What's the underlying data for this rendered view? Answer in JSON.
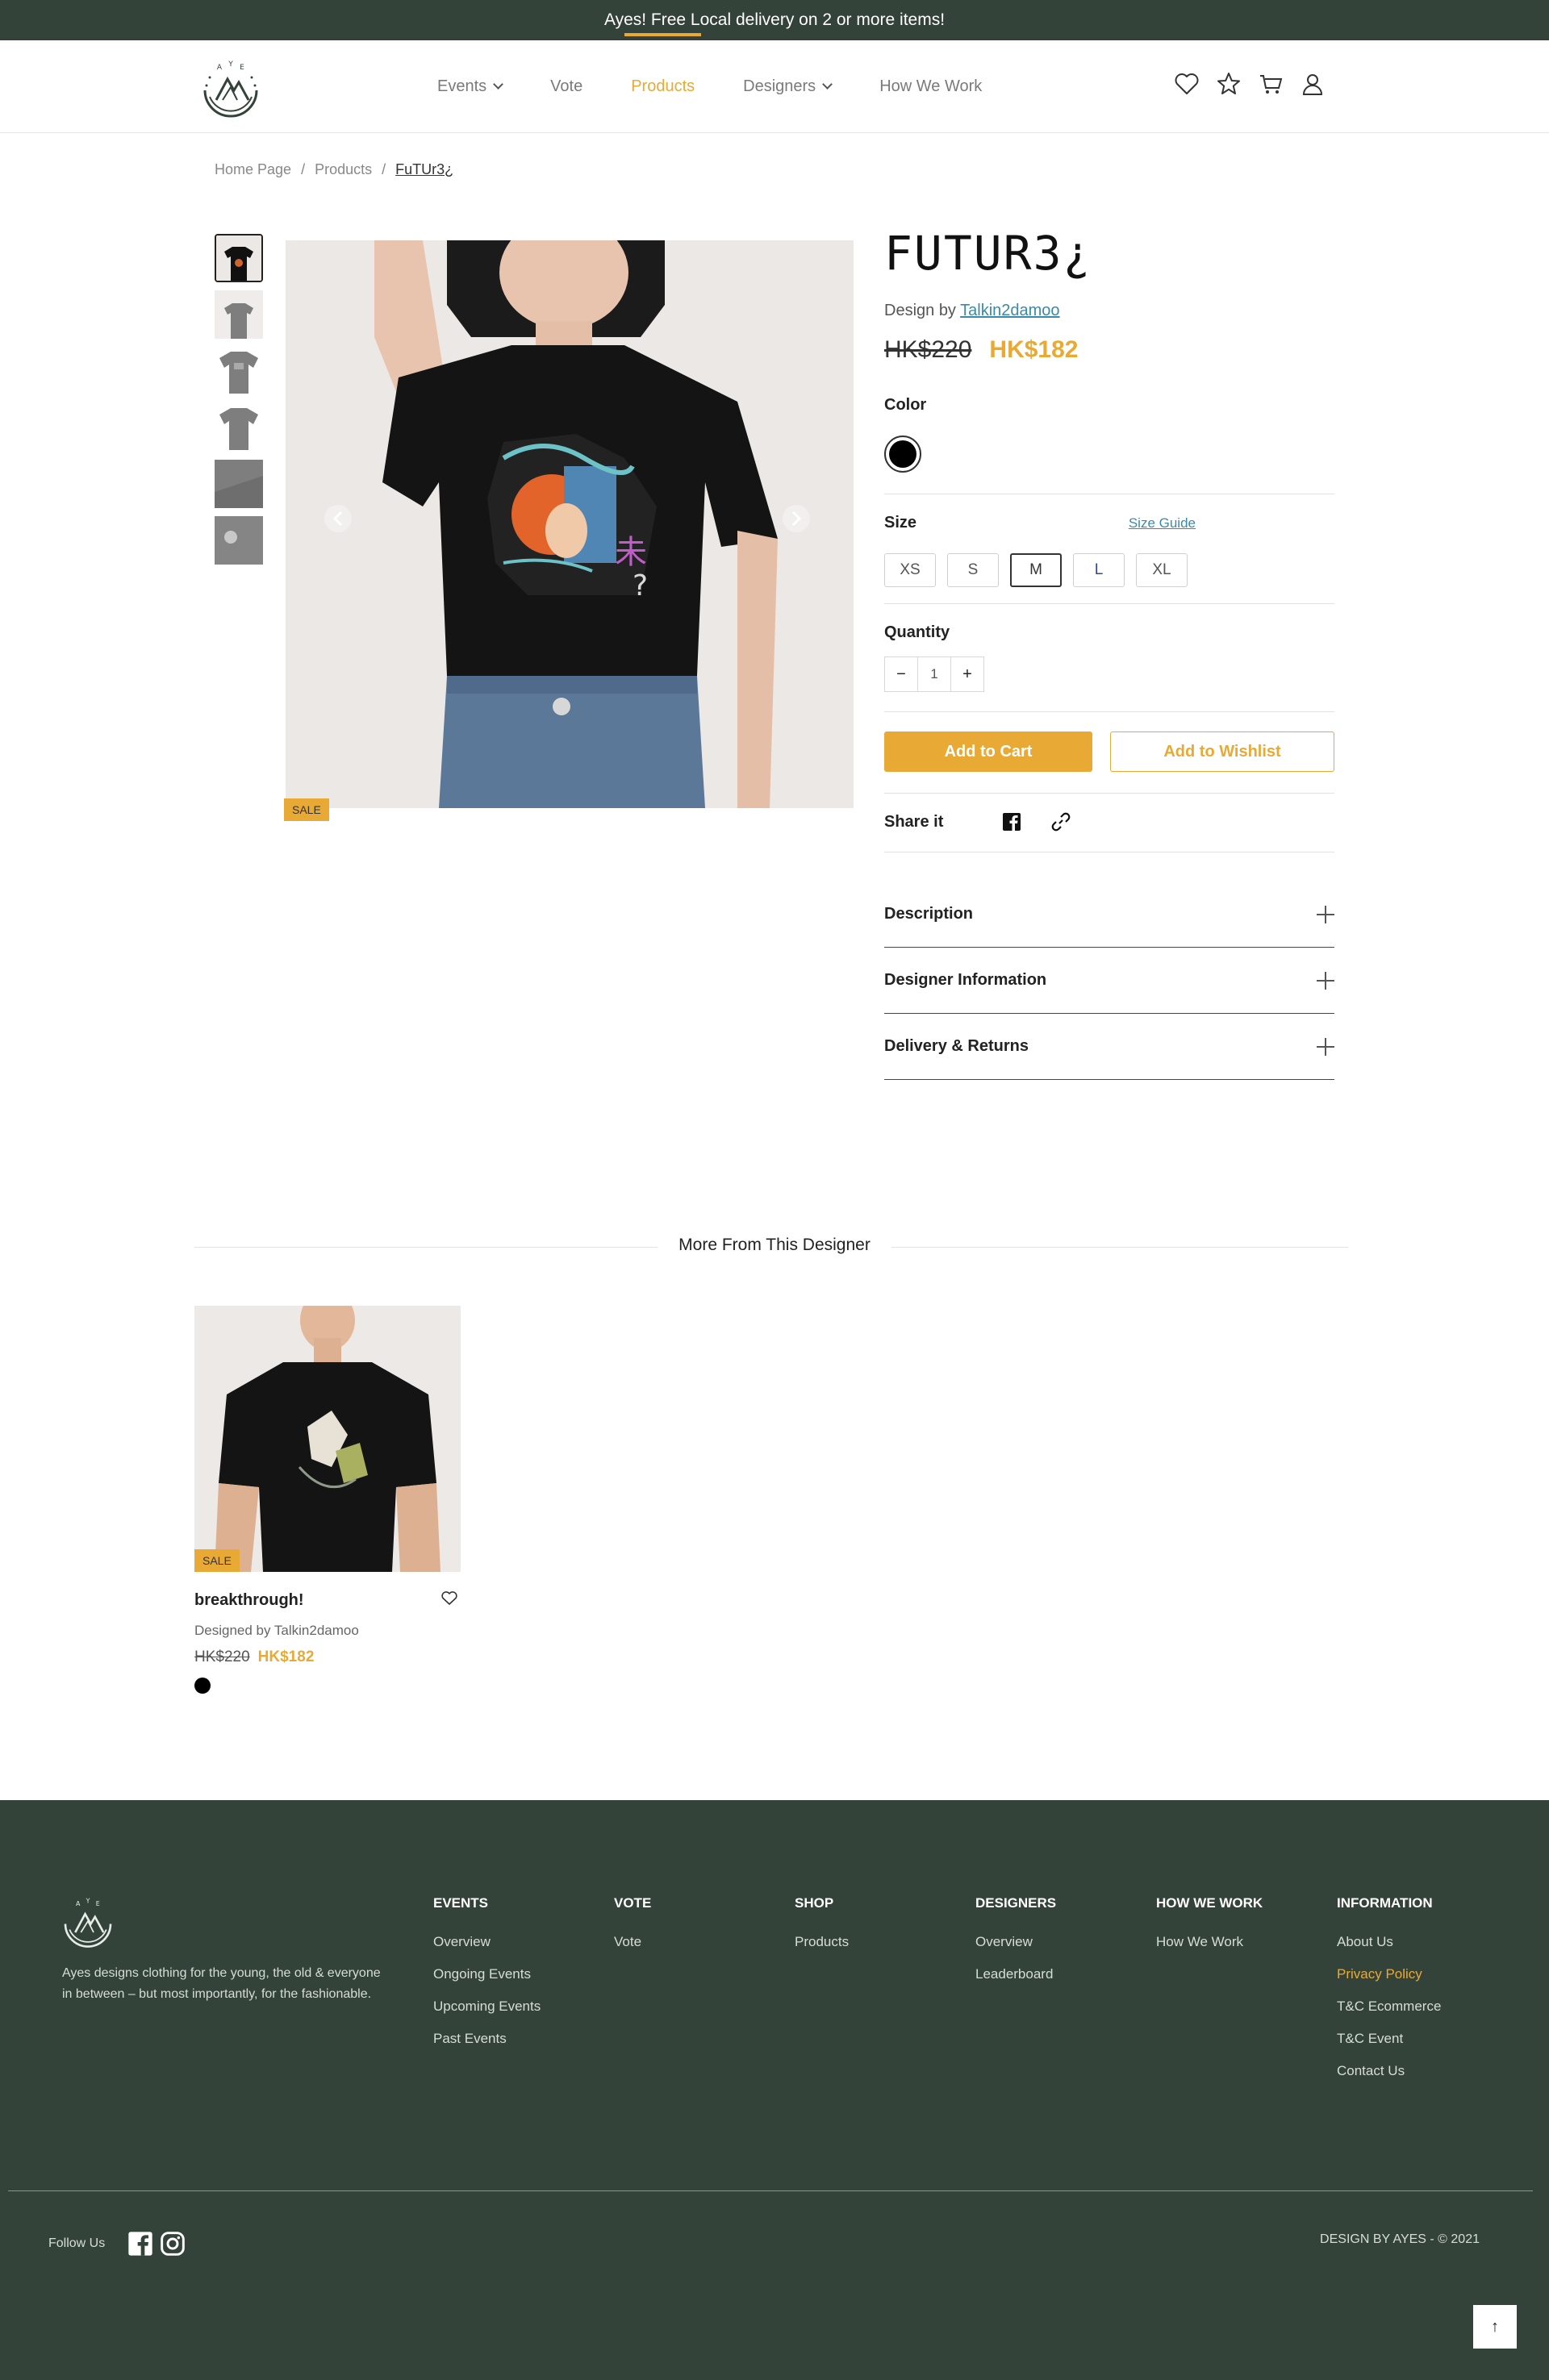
{
  "promo": {
    "text": "Ayes! Free Local delivery on 2 or more items!"
  },
  "nav": {
    "items": [
      {
        "label": "Events",
        "has_dropdown": true
      },
      {
        "label": "Vote",
        "has_dropdown": false
      },
      {
        "label": "Products",
        "has_dropdown": false,
        "active": true
      },
      {
        "label": "Designers",
        "has_dropdown": true
      },
      {
        "label": "How We Work",
        "has_dropdown": false
      }
    ],
    "icons": [
      "heart-icon",
      "star-icon",
      "cart-icon",
      "user-icon"
    ]
  },
  "breadcrumb": {
    "home": "Home Page",
    "products": "Products",
    "current": "FuTUr3¿"
  },
  "product": {
    "title": "FUTUR3¿",
    "design_by_prefix": "Design by",
    "designer": "Talkin2damoo",
    "old_price": "HK$220",
    "new_price": "HK$182",
    "sale_badge": "SALE",
    "color_label": "Color",
    "selected_color": "#000000",
    "size_label": "Size",
    "size_guide": "Size Guide",
    "sizes": [
      "XS",
      "S",
      "M",
      "L",
      "XL"
    ],
    "selected_size": "M",
    "quantity_label": "Quantity",
    "quantity": "1",
    "add_to_cart": "Add to Cart",
    "add_to_wishlist": "Add to Wishlist",
    "share_label": "Share it",
    "accordions": [
      "Description",
      "Designer Information",
      "Delivery & Returns"
    ]
  },
  "more": {
    "title": "More From This Designer",
    "items": [
      {
        "name": "breakthrough!",
        "designed_by": "Designed by Talkin2damoo",
        "old_price": "HK$220",
        "new_price": "HK$182",
        "badge": "SALE",
        "color": "#000000"
      }
    ]
  },
  "footer": {
    "description": "Ayes designs clothing for the young, the old & everyone in between – but most importantly, for the fashionable.",
    "columns": [
      {
        "heading": "EVENTS",
        "links": [
          "Overview",
          "Ongoing Events",
          "Upcoming Events",
          "Past Events"
        ]
      },
      {
        "heading": "VOTE",
        "links": [
          "Vote"
        ]
      },
      {
        "heading": "SHOP",
        "links": [
          "Products"
        ]
      },
      {
        "heading": "DESIGNERS",
        "links": [
          "Overview",
          "Leaderboard"
        ]
      },
      {
        "heading": "HOW WE WORK",
        "links": [
          "How We Work"
        ]
      },
      {
        "heading": "INFORMATION",
        "links": [
          "About Us",
          "Privacy Policy",
          "T&C Ecommerce",
          "T&C Event",
          "Contact Us"
        ]
      }
    ],
    "follow_us": "Follow Us",
    "copyright": "DESIGN BY AYES - © 2021",
    "back_to_top": "↑"
  },
  "colors": {
    "brand_dark": "#334339",
    "accent": "#e9a935",
    "link": "#3b8aa8"
  }
}
